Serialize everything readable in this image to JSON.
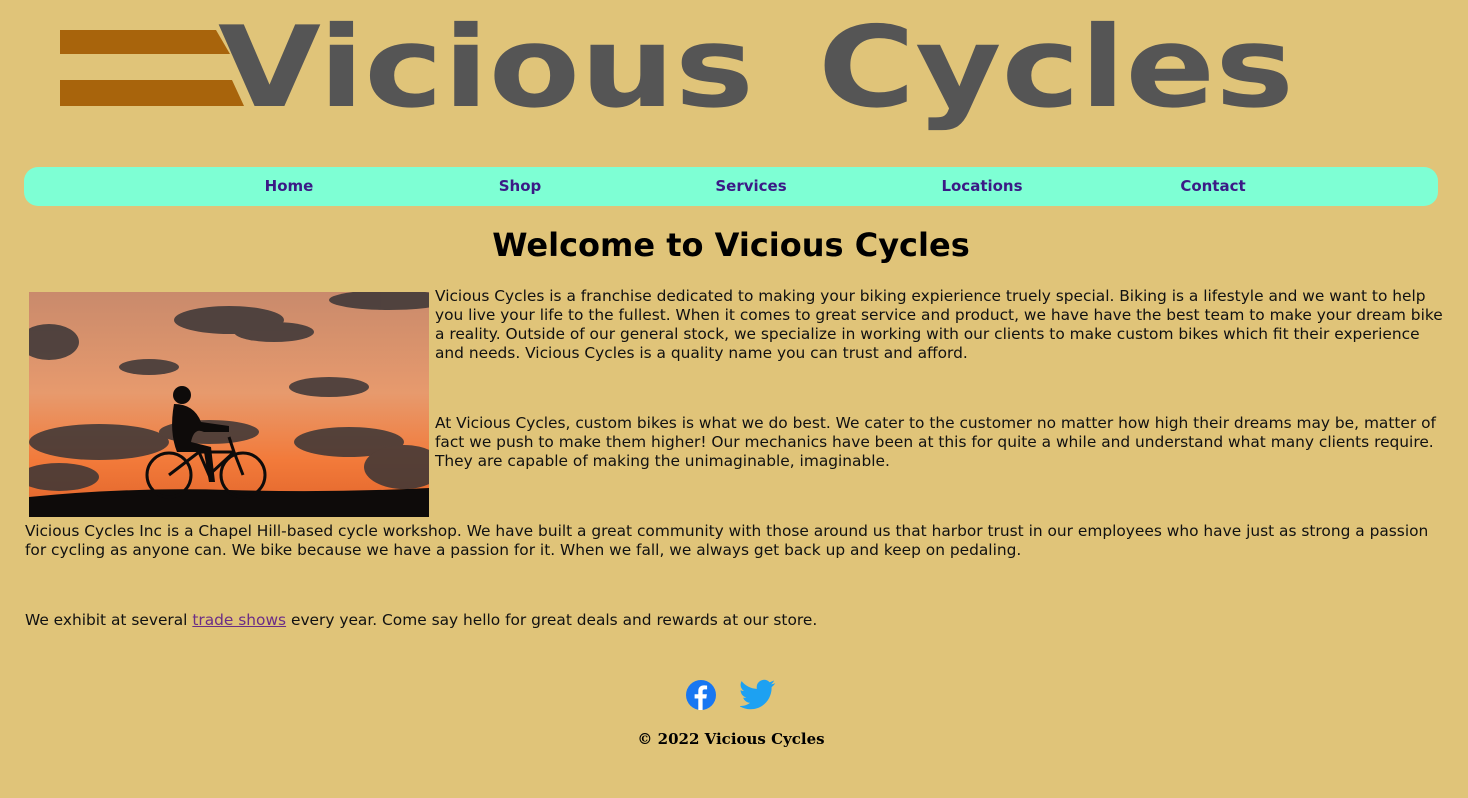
{
  "logo": {
    "word1": "Vicious",
    "word2": "Cycles",
    "text_color": "#555555",
    "stripe_color": "#a8640c"
  },
  "nav": {
    "items": [
      {
        "label": "Home"
      },
      {
        "label": "Shop"
      },
      {
        "label": "Services"
      },
      {
        "label": "Locations"
      },
      {
        "label": "Contact"
      }
    ],
    "background": "#7effd4",
    "link_color": "#3b1a86"
  },
  "main": {
    "title": "Welcome to Vicious Cycles",
    "paragraphs": [
      "Vicious Cycles is a franchise dedicated to making your biking expierience truely special. Biking is a lifestyle and we want to help you live your life to the fullest. When it comes to great service and product, we have have the best team to make your dream bike a reality. Outside of our general stock, we specialize in working with our clients to make custom bikes which fit their experience and needs. Vicious Cycles is a quality name you can trust and afford.",
      "At Vicious Cycles, custom bikes is what we do best. We cater to the customer no matter how high their dreams may be, matter of fact we push to make them higher! Our mechanics have been at this for quite a while and understand what many clients require. They are capable of making the unimaginable, imaginable.",
      "Vicious Cycles Inc is a Chapel Hill-based cycle workshop. We have built a great community with those around us that harbor trust in our employees who have just as strong a passion for cycling as anyone can. We bike because we have a passion for it. When we fall, we always get back up and keep on pedaling."
    ],
    "trade": {
      "before": "We exhibit at several ",
      "link": "trade shows",
      "after": " every year. Come say hello for great deals and rewards at our store."
    }
  },
  "footer": {
    "social": [
      {
        "icon": "facebook-icon",
        "color": "#1877f2"
      },
      {
        "icon": "twitter-icon",
        "color": "#1da1f2"
      }
    ],
    "copyright": "© 2022 Vicious Cycles"
  },
  "colors": {
    "page_background": "#e0c479"
  }
}
